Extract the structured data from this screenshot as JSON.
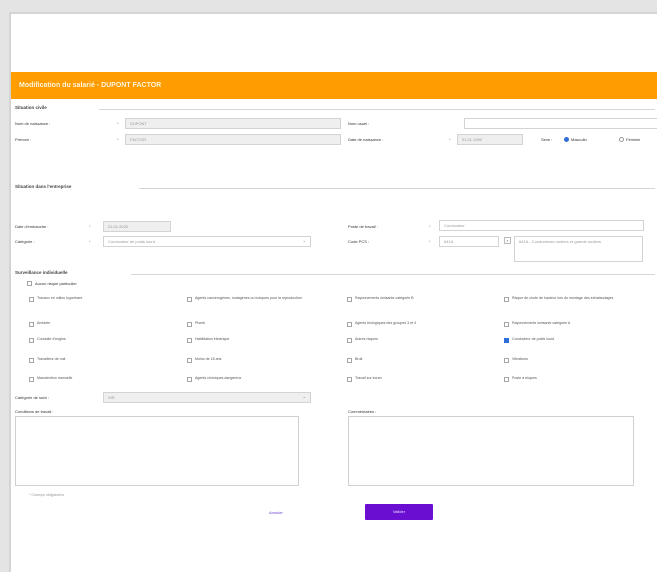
{
  "header": {
    "title": "Modification du salarié - DUPONT FACTOR"
  },
  "etat_civil": {
    "section_title": "Situation civile",
    "nom_label": "Nom de naissance :",
    "nom_value": "DUPONT",
    "prenom_label": "Prénom :",
    "prenom_value": "FACTOR",
    "nom_usuel_label": "Nom usuel :",
    "date_naissance_label": "Date de naissance :",
    "date_naissance_value": "01.01.1990",
    "sexe_label": "Sexe :",
    "sexe_options": [
      "Masculin",
      "Féminin"
    ],
    "sexe_selected": 0
  },
  "transport": {
    "section_title": "Situation dans l'entreprise",
    "date_embauche_label": "Date d'embauche :",
    "date_embauche_value": "01.01.2020",
    "poste_label": "Poste de travail :",
    "poste_value": "Conducteur",
    "statut_label": "Catégorie :",
    "statut_value": "Conducteur de poids lourd",
    "code_pcs_label": "Code PCS :",
    "code_pcs_value": "641A",
    "code_pcs_desc": "641A - Conducteurs routiers et grands routiers"
  },
  "surveillance": {
    "section_title": "Surveillance individuelle",
    "header_checkbox": "Aucun risque particulier",
    "options": [
      {
        "text": "Travaux en milieu hyperbare",
        "checked": false
      },
      {
        "text": "Agents cancérogènes, mutagènes ou toxiques pour la reproduction",
        "checked": false
      },
      {
        "text": "Rayonnements ionisants catégorie B",
        "checked": false
      },
      {
        "text": "Risque de chute de hauteur lors du montage des échafaudages",
        "checked": false
      },
      {
        "text": "Amiante",
        "checked": false
      },
      {
        "text": "Plomb",
        "checked": false
      },
      {
        "text": "Agents biologiques des groupes 3 et 4",
        "checked": false
      },
      {
        "text": "Rayonnements ionisants catégorie A",
        "checked": false
      },
      {
        "text": "Conduite d'engins",
        "checked": false
      },
      {
        "text": "Habilitation électrique",
        "checked": false
      },
      {
        "text": "Autres risques",
        "checked": false
      },
      {
        "text": "Conducteur de poids lourd",
        "checked": true
      },
      {
        "text": "Travailleur de nuit",
        "checked": false
      },
      {
        "text": "Moins de 18 ans",
        "checked": false
      },
      {
        "text": "Bruit",
        "checked": false
      },
      {
        "text": "Vibrations",
        "checked": false
      },
      {
        "text": "Manutention manuelle",
        "checked": false
      },
      {
        "text": "Agents chimiques dangereux",
        "checked": false
      },
      {
        "text": "Travail sur écran",
        "checked": false
      },
      {
        "text": "Poste à risques",
        "checked": false
      }
    ],
    "categorie_label": "Catégorie de suivi :",
    "categorie_value": "SIR"
  },
  "comments": {
    "left_label": "Conditions de travail :",
    "right_label": "Commentaires :"
  },
  "footer": {
    "note": "* Champs obligatoires",
    "cancel_label": "Annuler",
    "submit_label": "Valider"
  },
  "colors": {
    "header": "#ff9c00",
    "submit": "#6a0fd1",
    "checked": "#2e6ed8"
  }
}
